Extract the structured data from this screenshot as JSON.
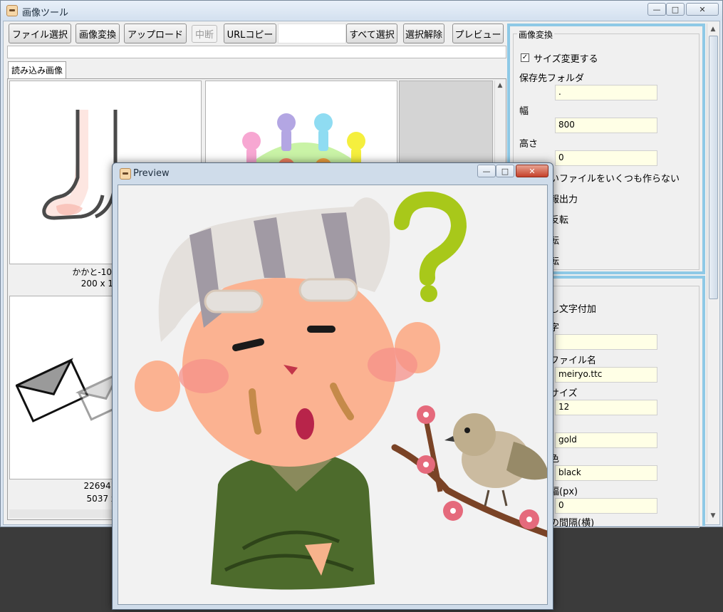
{
  "main_window": {
    "title": "画像ツール",
    "caption_buttons": {
      "minimize": "—",
      "maximize": "□",
      "close": "✕"
    }
  },
  "toolbar": {
    "file_select": "ファイル選択",
    "image_convert": "画像変換",
    "upload": "アップロード",
    "abort": "中断",
    "copy_url": "URLコピー",
    "select_all": "すべて選択",
    "deselect": "選択解除",
    "preview": "プレビュー"
  },
  "tabs": [
    {
      "label": "読み込み画像"
    }
  ],
  "thumbnails": [
    {
      "name": "かかと-1024x10",
      "info": "200 x 176 |",
      "icon": "heel-foot-illustration"
    },
    {
      "name": "",
      "info": "",
      "icon": "colorful-people-pins-illustration"
    },
    {
      "name": "",
      "info": "",
      "icon": "blank-image"
    },
    {
      "name": "22694187",
      "info": "5037 x 1",
      "icon": "envelope-illustration"
    }
  ],
  "convert_panel": {
    "group_title": "画像変換",
    "resize_checkbox": {
      "label": "サイズ変更する",
      "checked": true
    },
    "dest_folder": {
      "label": "保存先フォルダ",
      "value": "."
    },
    "width": {
      "label": "幅",
      "value": "800"
    },
    "height": {
      "label": "高さ",
      "value": "0"
    },
    "option1": "いファイルをいくつも作らない",
    "option2": "報出力",
    "option3": "反転",
    "option4": "転",
    "option5": "転"
  },
  "watermark_panel": {
    "title": "し文字付加",
    "text_label": "字",
    "text_value": "",
    "font_file_label": "ファイル名",
    "font_file_value": "meiryo.ttc",
    "font_size_label": "サイズ",
    "font_size_value": "12",
    "color_value": "gold",
    "border_color_label": "色",
    "border_color_value": "black",
    "border_width_label": "幅(px)",
    "border_width_value": "0",
    "spacing_label": "の間隔(横)"
  },
  "preview_window": {
    "title": "Preview",
    "image": "old-man-with-question-mark-and-bird-illustration"
  },
  "colors": {
    "accent": "#8ec9e6",
    "field_bg": "#ffffe6",
    "question_mark": "#a8c81a"
  }
}
